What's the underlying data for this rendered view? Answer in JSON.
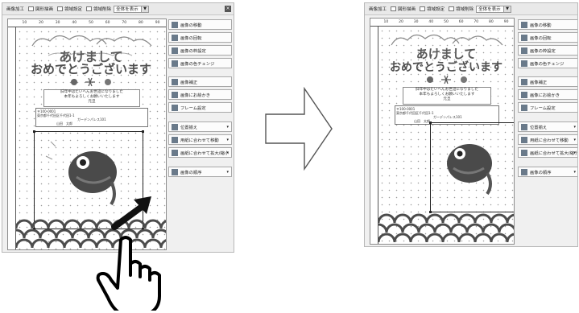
{
  "toolbar": {
    "menu1": "画像加工",
    "menu2": "図形描画",
    "menu3": "領域設定",
    "menu4": "領域削除",
    "view_select": "全体を表示",
    "close": "×"
  },
  "ruler": {
    "top_ticks": [
      "10",
      "20",
      "30",
      "40",
      "50",
      "60",
      "70",
      "80",
      "90"
    ],
    "left_ticks": [
      "10",
      "20",
      "30",
      "40",
      "50",
      "60",
      "70",
      "80",
      "90",
      "100",
      "110",
      "120",
      "130",
      "140"
    ]
  },
  "card": {
    "title_line1": "あけまして",
    "title_line2": "おめでとうございます",
    "message": [
      "旧年中はたいへんお世話になりました",
      "本年もよろしくお願いいたします",
      "元旦"
    ],
    "address_lines": [
      "〒100-0001",
      "東京都千代田区千代田1-1",
      "ガーデンパレス101",
      "山田　太郎"
    ]
  },
  "sidebar_before": [
    {
      "label": "画像の移動"
    },
    {
      "label": "画像の回転"
    },
    {
      "label": "画像の枠設定"
    },
    {
      "label": "画像の色チェンジ"
    },
    {
      "label": "画像補正"
    },
    {
      "label": "画像にお絵かき"
    },
    {
      "label": "フレーム設定"
    },
    {
      "label": "位置揃え"
    },
    {
      "label": "用紙に合わせて移動"
    },
    {
      "label": "画紙に合わせて拡大/縮小"
    },
    {
      "label": "画像の順序"
    }
  ],
  "sidebar_after": [
    {
      "label": "画像の移動"
    },
    {
      "label": "画像の回転"
    },
    {
      "label": "画像の枠設定"
    },
    {
      "label": "画像の色チェンジ"
    },
    {
      "label": "画像補正"
    },
    {
      "label": "画像にお絵かき"
    },
    {
      "label": "フレーム設定"
    },
    {
      "label": "位置揃え"
    },
    {
      "label": "用紙に合わせて移動"
    },
    {
      "label": "画紙に合わせて拡大/縮小"
    },
    {
      "label": "画像の順序"
    }
  ],
  "colors": {
    "panel_bg": "#f0f0f0",
    "carp": "#4a4a4a",
    "wave": "#555555",
    "hand_outline": "#000000"
  }
}
